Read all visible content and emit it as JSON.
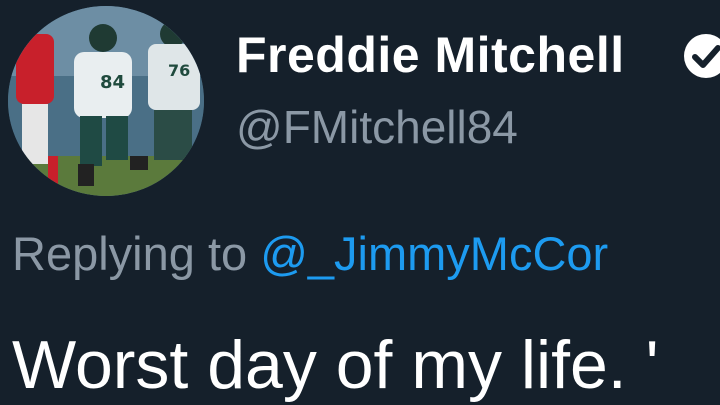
{
  "author": {
    "display_name": "Freddie Mitchell",
    "handle": "@FMitchell84",
    "verified": true
  },
  "reply": {
    "prefix": "Replying to",
    "mention": "@_JimmyMcCor"
  },
  "tweet": {
    "text": "Worst day of my life. '"
  },
  "colors": {
    "background": "#15202b",
    "secondary_text": "#8b98a5",
    "link": "#1d9bf0"
  },
  "icons": {
    "verified": "verified-check-icon"
  }
}
